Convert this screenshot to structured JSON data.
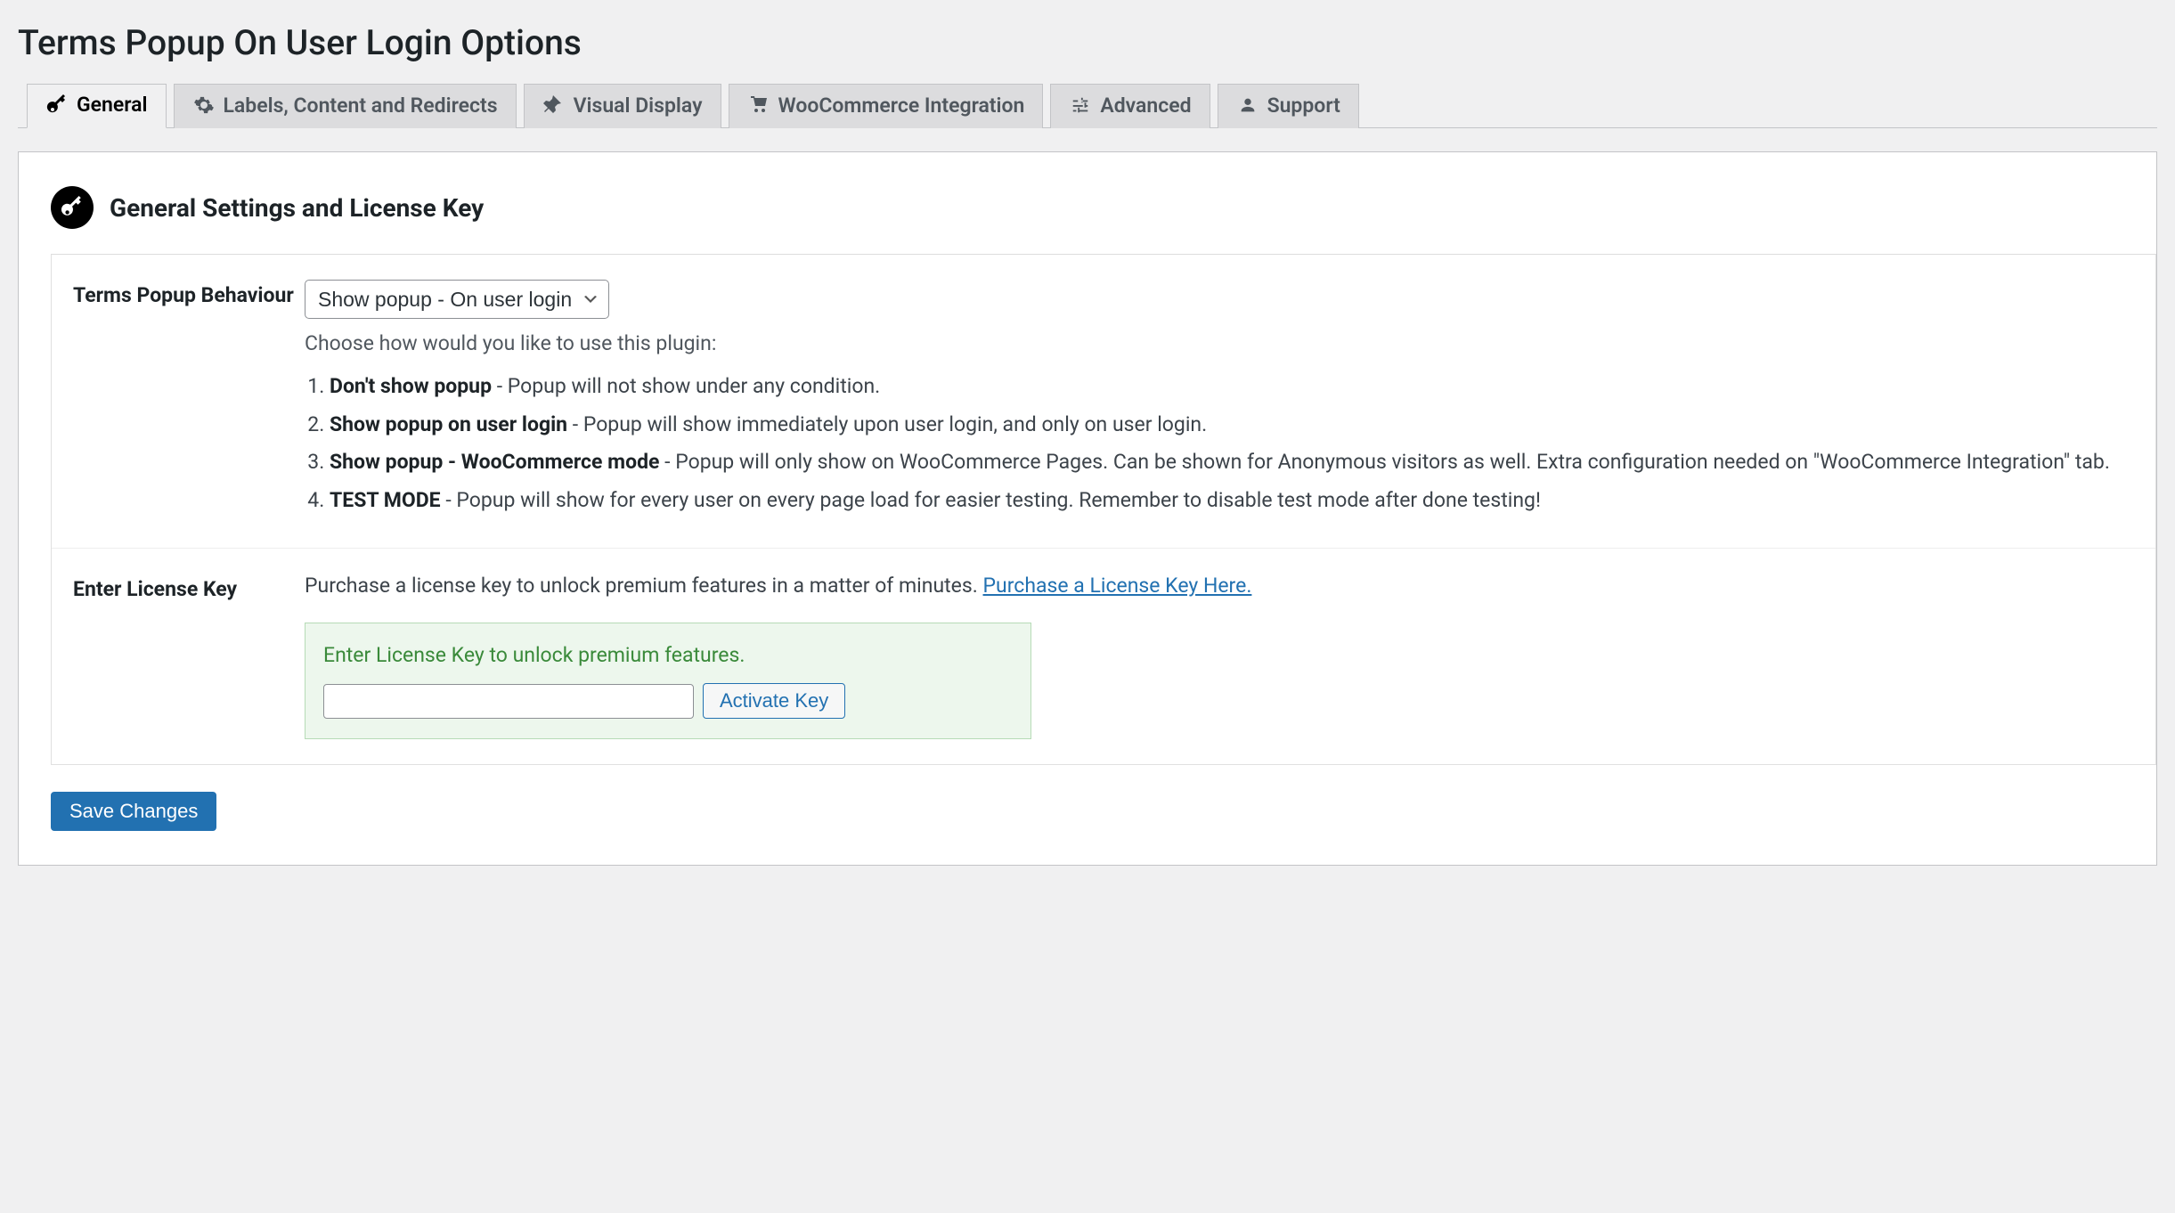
{
  "page_title": "Terms Popup On User Login Options",
  "tabs": [
    {
      "label": "General"
    },
    {
      "label": "Labels, Content and Redirects"
    },
    {
      "label": "Visual Display"
    },
    {
      "label": "WooCommerce Integration"
    },
    {
      "label": "Advanced"
    },
    {
      "label": "Support"
    }
  ],
  "section_title": "General Settings and License Key",
  "behaviour": {
    "label": "Terms Popup Behaviour",
    "selected": "Show popup - On user login",
    "help": "Choose how would you like to use this plugin:",
    "options": [
      {
        "bold": "Don't show popup",
        "rest": " - Popup will not show under any condition."
      },
      {
        "bold": "Show popup on user login",
        "rest": " - Popup will show immediately upon user login, and only on user login."
      },
      {
        "bold": "Show popup - WooCommerce mode",
        "rest": " - Popup will only show on WooCommerce Pages. Can be shown for Anonymous visitors as well. Extra configuration needed on \"WooCommerce Integration\" tab."
      },
      {
        "bold": "TEST MODE",
        "rest": " - Popup will show for every user on every page load for easier testing. Remember to disable test mode after done testing!"
      }
    ]
  },
  "license": {
    "label": "Enter License Key",
    "purchase_text": "Purchase a license key to unlock premium features in a matter of minutes. ",
    "purchase_link": "Purchase a License Key Here.",
    "box_title": "Enter License Key to unlock premium features.",
    "activate_label": "Activate Key",
    "input_value": ""
  },
  "save_label": "Save Changes"
}
